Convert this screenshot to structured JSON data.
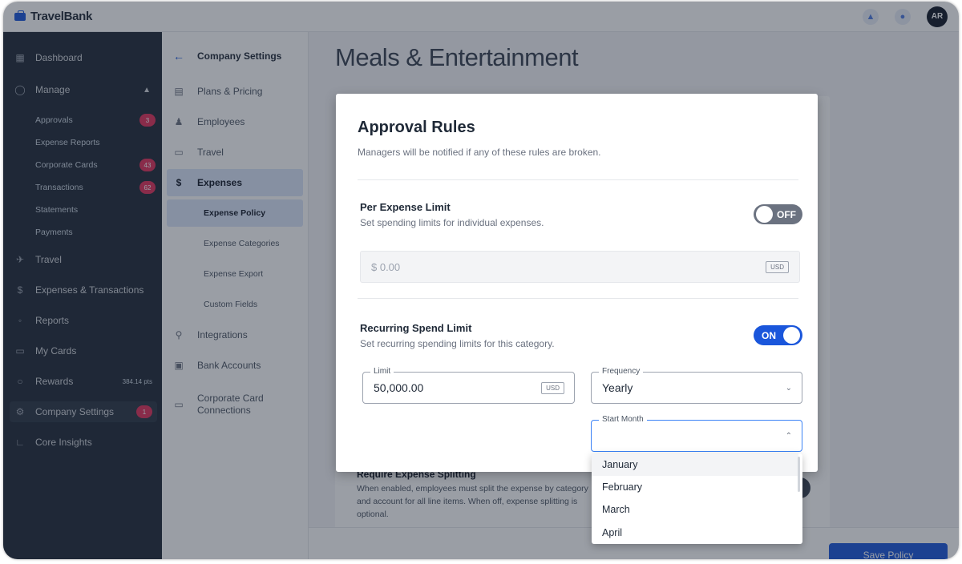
{
  "app": {
    "name": "TravelBank",
    "user_initials": "AR",
    "accent_color": "#1a56db",
    "badge_color": "#e1315a"
  },
  "topbar": {
    "notifications_icon": "bell-icon",
    "help_icon": "help-icon"
  },
  "sidebar": {
    "items": [
      {
        "label": "Dashboard",
        "icon": "dashboard-icon"
      },
      {
        "label": "Manage",
        "icon": "check-circle-icon",
        "expanded": true
      },
      {
        "label": "Travel",
        "icon": "plane-icon"
      },
      {
        "label": "Expenses & Transactions",
        "icon": "dollar-icon"
      },
      {
        "label": "Reports",
        "icon": "reports-icon"
      },
      {
        "label": "My Cards",
        "icon": "card-icon"
      },
      {
        "label": "Rewards",
        "icon": "award-icon",
        "points": "384.14 pts"
      },
      {
        "label": "Company Settings",
        "icon": "gear-icon",
        "badge": "1",
        "active": true
      },
      {
        "label": "Core Insights",
        "icon": "chart-icon"
      }
    ],
    "manage_subitems": [
      {
        "label": "Approvals",
        "badge": "3"
      },
      {
        "label": "Expense Reports"
      },
      {
        "label": "Corporate Cards",
        "badge": "43"
      },
      {
        "label": "Transactions",
        "badge": "62"
      },
      {
        "label": "Statements"
      },
      {
        "label": "Payments"
      }
    ]
  },
  "settings_nav": {
    "header": "Company Settings",
    "items": [
      {
        "label": "Plans & Pricing",
        "icon": "plans-icon"
      },
      {
        "label": "Employees",
        "icon": "people-icon"
      },
      {
        "label": "Travel",
        "icon": "suitcase-icon"
      },
      {
        "label": "Expenses",
        "icon": "dollar-icon",
        "selected": true
      },
      {
        "label": "Integrations",
        "icon": "integrations-icon"
      },
      {
        "label": "Bank Accounts",
        "icon": "bank-icon"
      },
      {
        "label": "Corporate Card Connections",
        "icon": "card-icon"
      }
    ],
    "expense_subitems": [
      {
        "label": "Expense Policy",
        "selected": true
      },
      {
        "label": "Expense Categories"
      },
      {
        "label": "Expense Export"
      },
      {
        "label": "Custom Fields"
      }
    ]
  },
  "main": {
    "page_title": "Meals & Entertainment",
    "background_section": {
      "title": "Require Expense Splitting",
      "description": "When enabled, employees must split the expense by category and account for all line items. When off, expense splitting is optional."
    },
    "save_label": "Save Policy"
  },
  "modal": {
    "title": "Approval Rules",
    "subtitle": "Managers will be notified if any of these rules are broken.",
    "per_expense": {
      "title": "Per Expense Limit",
      "description": "Set spending limits for individual expenses.",
      "toggle_state": "OFF",
      "amount_value": "$ 0.00",
      "currency": "USD"
    },
    "recurring": {
      "title": "Recurring Spend Limit",
      "description": "Set recurring spending limits for this category.",
      "toggle_state": "ON",
      "limit_label": "Limit",
      "limit_value": "50,000.00",
      "limit_currency": "USD",
      "frequency_label": "Frequency",
      "frequency_value": "Yearly",
      "start_month_label": "Start Month",
      "start_month_value": ""
    }
  },
  "dropdown": {
    "options": [
      "January",
      "February",
      "March",
      "April"
    ],
    "highlighted": "January"
  }
}
